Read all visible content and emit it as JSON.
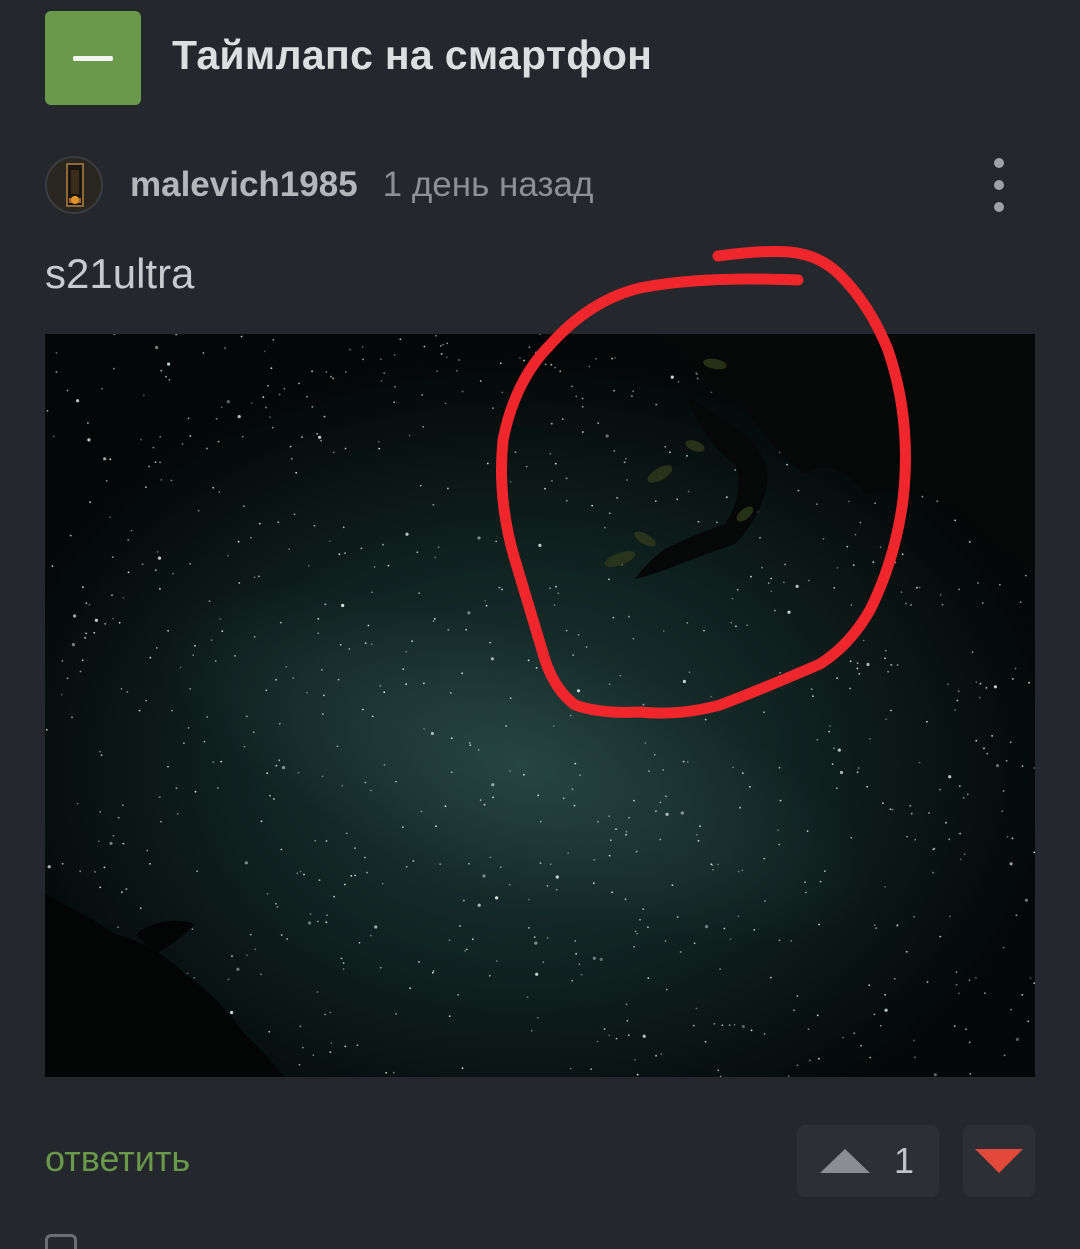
{
  "story": {
    "title": "Таймлапс на смартфон"
  },
  "comment": {
    "author": "malevich1985",
    "time_ago": "1 день назад",
    "text": "s21ultra",
    "image_alt": "Night sky with stars and tree branches, circled annotation"
  },
  "actions": {
    "reply_label": "ответить",
    "vote_count": "1"
  },
  "colors": {
    "background": "#24272b",
    "accent_green": "#6a994c",
    "downvote_red": "#e2493b",
    "annotation_red": "#f0262d"
  },
  "icons": {
    "collapse": "minus-icon",
    "more": "more-vertical-icon",
    "upvote": "triangle-up-icon",
    "downvote": "triangle-down-icon"
  }
}
